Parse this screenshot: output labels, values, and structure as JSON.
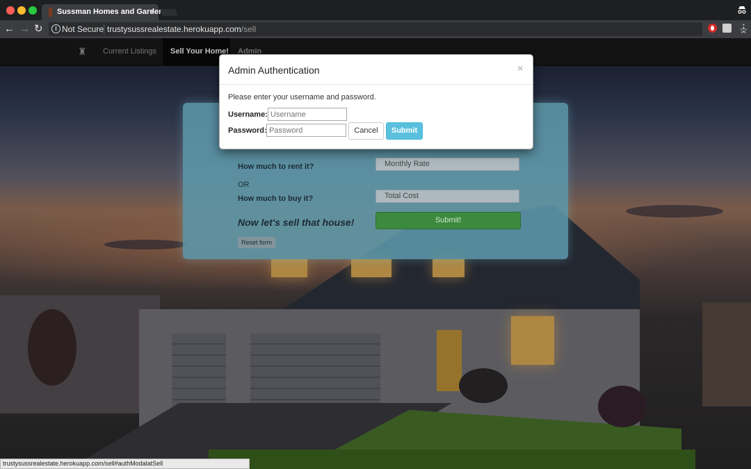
{
  "browser": {
    "tab_title": "Sussman Homes and Gardens",
    "tab_close": "×",
    "security_label": "Not Secure",
    "url_host": "trustysussrealestate.herokuapp.com",
    "url_path": "/sell",
    "status_url": "trustysussrealestate.herokuapp.com/sell#authModalatSell"
  },
  "site_nav": {
    "items": [
      {
        "label": "Current Listings"
      },
      {
        "label": "Sell Your Home!"
      },
      {
        "label": "Admin"
      }
    ]
  },
  "sell_form": {
    "rent_question": "How much to rent it?",
    "rent_placeholder": "Monthly Rate",
    "or_text": "OR",
    "buy_question": "How much to buy it?",
    "buy_placeholder": "Total Cost",
    "cta_text": "Now let's sell that house!",
    "submit_label": "Submit!",
    "reset_label": "Reset form"
  },
  "modal": {
    "title": "Admin Authentication",
    "close": "×",
    "prompt": "Please enter your username and password.",
    "username_label": "Username:",
    "username_placeholder": "Username",
    "password_label": "Password:",
    "password_placeholder": "Password",
    "cancel_label": "Cancel",
    "submit_label": "Submit"
  },
  "colors": {
    "submit_blue": "#5bc0de",
    "form_submit_green": "#3c8a3e",
    "panel_teal": "#5c97aa"
  }
}
